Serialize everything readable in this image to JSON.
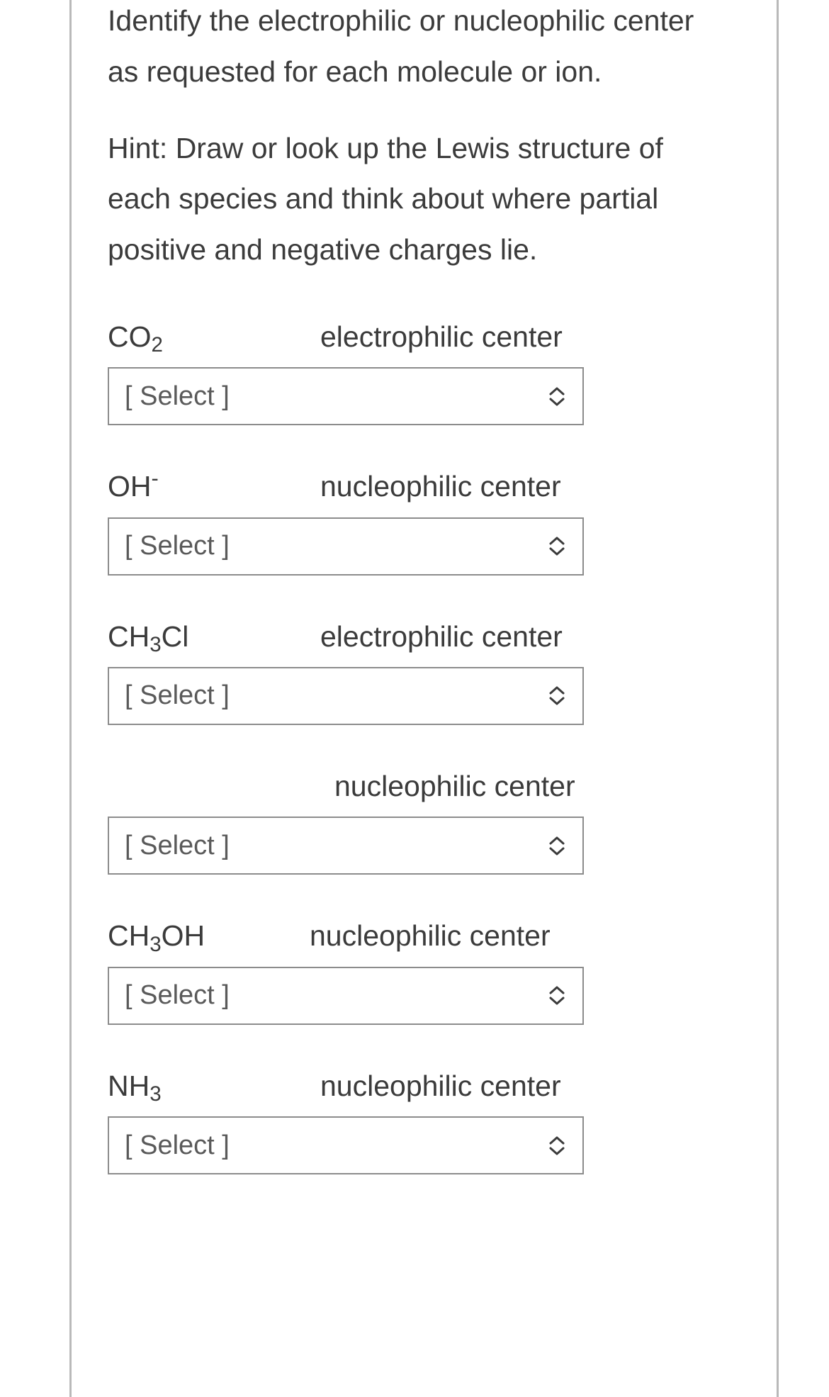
{
  "intro": "Identify the electrophilic or nucleophilic center as requested for each molecule or ion.",
  "hint": "Hint: Draw or look up the Lewis structure of each species and think about where partial positive and negative charges lie.",
  "select_placeholder": "[ Select ]",
  "items": [
    {
      "formula_html": "CO<sub>2</sub>",
      "type": "electrophilic center"
    },
    {
      "formula_html": "OH<sup class='minus'>-</sup>",
      "type": "nucleophilic center"
    },
    {
      "formula_html": "CH<sub>3</sub>Cl",
      "type": "electrophilic center"
    },
    {
      "formula_html": "",
      "type": "nucleophilic center"
    },
    {
      "formula_html": "CH<sub>3</sub>OH",
      "type": "nucleophilic center"
    },
    {
      "formula_html": "NH<sub>3</sub>",
      "type": "nucleophilic center"
    }
  ]
}
